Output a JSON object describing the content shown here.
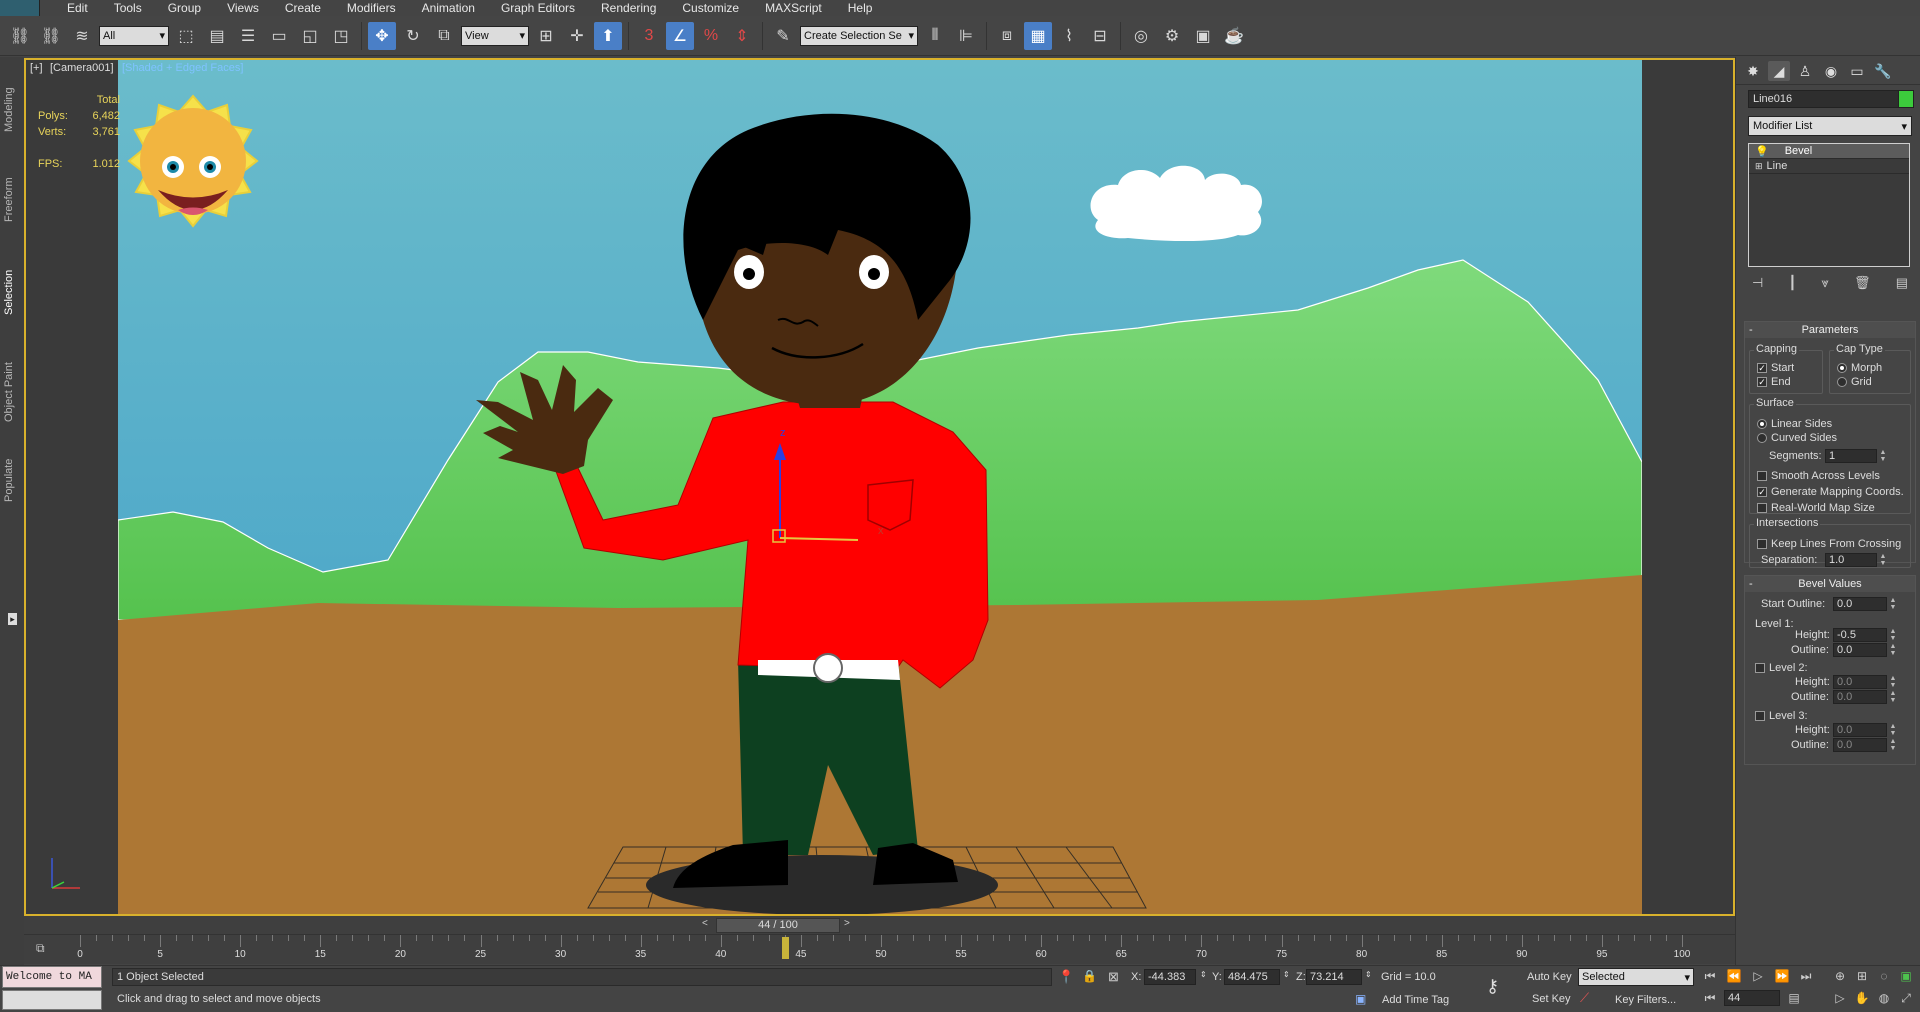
{
  "menu": [
    "Edit",
    "Tools",
    "Group",
    "Views",
    "Create",
    "Modifiers",
    "Animation",
    "Graph Editors",
    "Rendering",
    "Customize",
    "MAXScript",
    "Help"
  ],
  "toolbar": {
    "filter_value": "All",
    "refcoord_value": "View",
    "selset_placeholder": "Create Selection Se",
    "snap_label": "3",
    "percent_label": "%"
  },
  "left_tabs": [
    "Modeling",
    "Freeform",
    "Selection",
    "Object Paint",
    "Populate"
  ],
  "viewport": {
    "label_plus": "[+]",
    "label_camera": "[Camera001]",
    "label_shading": "[Shaded + Edged Faces]",
    "stats_header": "Total",
    "polys_label": "Polys:",
    "polys_value": "6,482",
    "verts_label": "Verts:",
    "verts_value": "3,761",
    "fps_label": "FPS:",
    "fps_value": "1.012",
    "gizmo_z": "z",
    "gizmo_x": "x"
  },
  "command_panel": {
    "object_name": "Line016",
    "object_color": "#3ccb3c",
    "modifier_list_label": "Modifier List",
    "stack_items": [
      "Bevel",
      "Line"
    ],
    "parameters": {
      "title": "Parameters",
      "capping_title": "Capping",
      "cap_start": "Start",
      "cap_end": "End",
      "captype_title": "Cap Type",
      "morph": "Morph",
      "grid": "Grid",
      "surface_title": "Surface",
      "linear_sides": "Linear Sides",
      "curved_sides": "Curved Sides",
      "segments_label": "Segments:",
      "segments_value": "1",
      "smooth_levels": "Smooth Across Levels",
      "gen_mapping": "Generate Mapping Coords.",
      "real_world": "Real-World Map Size",
      "intersections_title": "Intersections",
      "keep_lines": "Keep Lines From Crossing",
      "separation_label": "Separation:",
      "separation_value": "1.0"
    },
    "bevel_values": {
      "title": "Bevel Values",
      "start_outline_label": "Start Outline:",
      "start_outline_value": "0.0",
      "level1_label": "Level 1:",
      "height_label": "Height:",
      "outline_label": "Outline:",
      "l1_height": "-0.5",
      "l1_outline": "0.0",
      "level2_label": "Level 2:",
      "l2_height": "0.0",
      "l2_outline": "0.0",
      "level3_label": "Level 3:",
      "l3_height": "0.0",
      "l3_outline": "0.0"
    }
  },
  "timeline": {
    "frame_display": "44 / 100",
    "current_frame": 44,
    "max_frame": 100,
    "tick_labels": [
      "0",
      "5",
      "10",
      "15",
      "20",
      "25",
      "30",
      "35",
      "40",
      "45",
      "50",
      "55",
      "60",
      "65",
      "70",
      "75",
      "80",
      "85",
      "90",
      "95",
      "100"
    ]
  },
  "status": {
    "maxscript_text": "Welcome to MA",
    "selection_text": "1 Object Selected",
    "prompt_text": "Click and drag to select and move objects",
    "x_label": "X:",
    "x_value": "-44.383",
    "y_label": "Y:",
    "y_value": "484.475",
    "z_label": "Z:",
    "z_value": "73.214",
    "grid_text": "Grid = 10.0",
    "add_time_tag": "Add Time Tag",
    "auto_key": "Auto Key",
    "set_key": "Set Key",
    "key_mode_value": "Selected",
    "key_filters": "Key Filters...",
    "frame_field": "44"
  }
}
